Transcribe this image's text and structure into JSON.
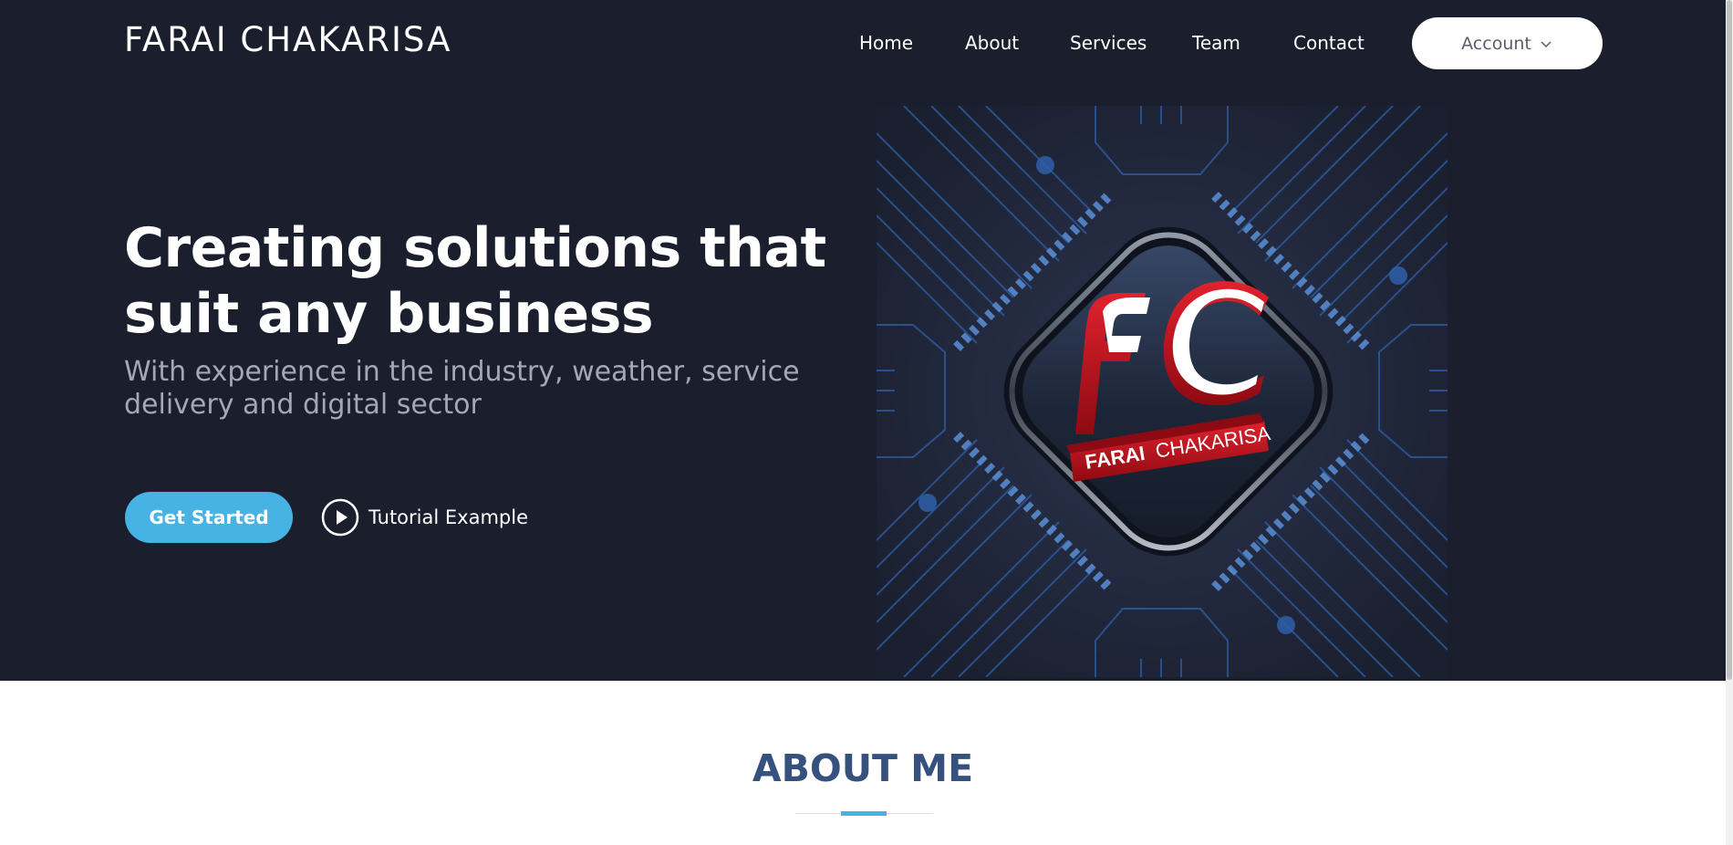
{
  "brand": {
    "name": "FARAI CHAKARISA"
  },
  "nav": {
    "items": [
      {
        "label": "Home"
      },
      {
        "label": "About"
      },
      {
        "label": "Services"
      },
      {
        "label": "Team"
      },
      {
        "label": "Contact"
      }
    ],
    "account": {
      "label": "Account",
      "icon": "chevron-down-icon"
    }
  },
  "hero": {
    "headline": "Creating solutions that suit any business",
    "subline": "With experience in the industry, weather, service delivery and digital sector",
    "cta_label": "Get Started",
    "tutorial_label": "Tutorial Example",
    "tutorial_icon": "play-icon",
    "graphic": {
      "monogram": "FC",
      "banner_text_1": "FARAI",
      "banner_text_2": "CHAKARISA"
    }
  },
  "about": {
    "title": "ABOUT ME"
  },
  "colors": {
    "hero_bg": "#1b1f2d",
    "accent": "#47b2e4",
    "about_title": "#37517e",
    "logo_red": "#c8101e"
  }
}
